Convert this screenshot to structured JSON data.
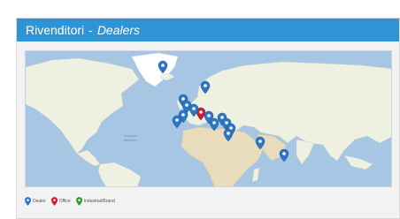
{
  "header": {
    "title": "Rivenditori",
    "separator": "-",
    "subtitle": "Dealers"
  },
  "map": {
    "ocean_label_1": "Oceano",
    "ocean_label_2": "Atlantico",
    "colors": {
      "ocean": "#a7c6e3",
      "land": "#eef0e2",
      "greenland": "#ffffff",
      "desert": "#e9dcbc",
      "dealer": "#2d78c6",
      "office": "#d11c2a",
      "industrial": "#2e9a35"
    },
    "markers": [
      {
        "type": "dealer",
        "region": "Iceland"
      },
      {
        "type": "dealer",
        "region": "Scandinavia"
      },
      {
        "type": "dealer",
        "region": "United Kingdom"
      },
      {
        "type": "dealer",
        "region": "France"
      },
      {
        "type": "dealer",
        "region": "Spain"
      },
      {
        "type": "dealer",
        "region": "Portugal"
      },
      {
        "type": "office",
        "region": "Italy"
      },
      {
        "type": "dealer",
        "region": "Central Europe"
      },
      {
        "type": "dealer",
        "region": "Balkans"
      },
      {
        "type": "dealer",
        "region": "Greece"
      },
      {
        "type": "dealer",
        "region": "Turkey"
      },
      {
        "type": "dealer",
        "region": "Eastern Europe"
      },
      {
        "type": "dealer",
        "region": "Middle East"
      },
      {
        "type": "dealer",
        "region": "Egypt"
      },
      {
        "type": "dealer",
        "region": "Gulf"
      },
      {
        "type": "dealer",
        "region": "India"
      }
    ]
  },
  "legend": {
    "items": [
      {
        "label": "Dealer",
        "color": "#2d78c6",
        "icon": "map-pin-icon"
      },
      {
        "label": "Office",
        "color": "#d11c2a",
        "icon": "map-pin-icon"
      },
      {
        "label": "Industrial/Brand",
        "color": "#2e9a35",
        "icon": "map-pin-icon"
      }
    ]
  }
}
